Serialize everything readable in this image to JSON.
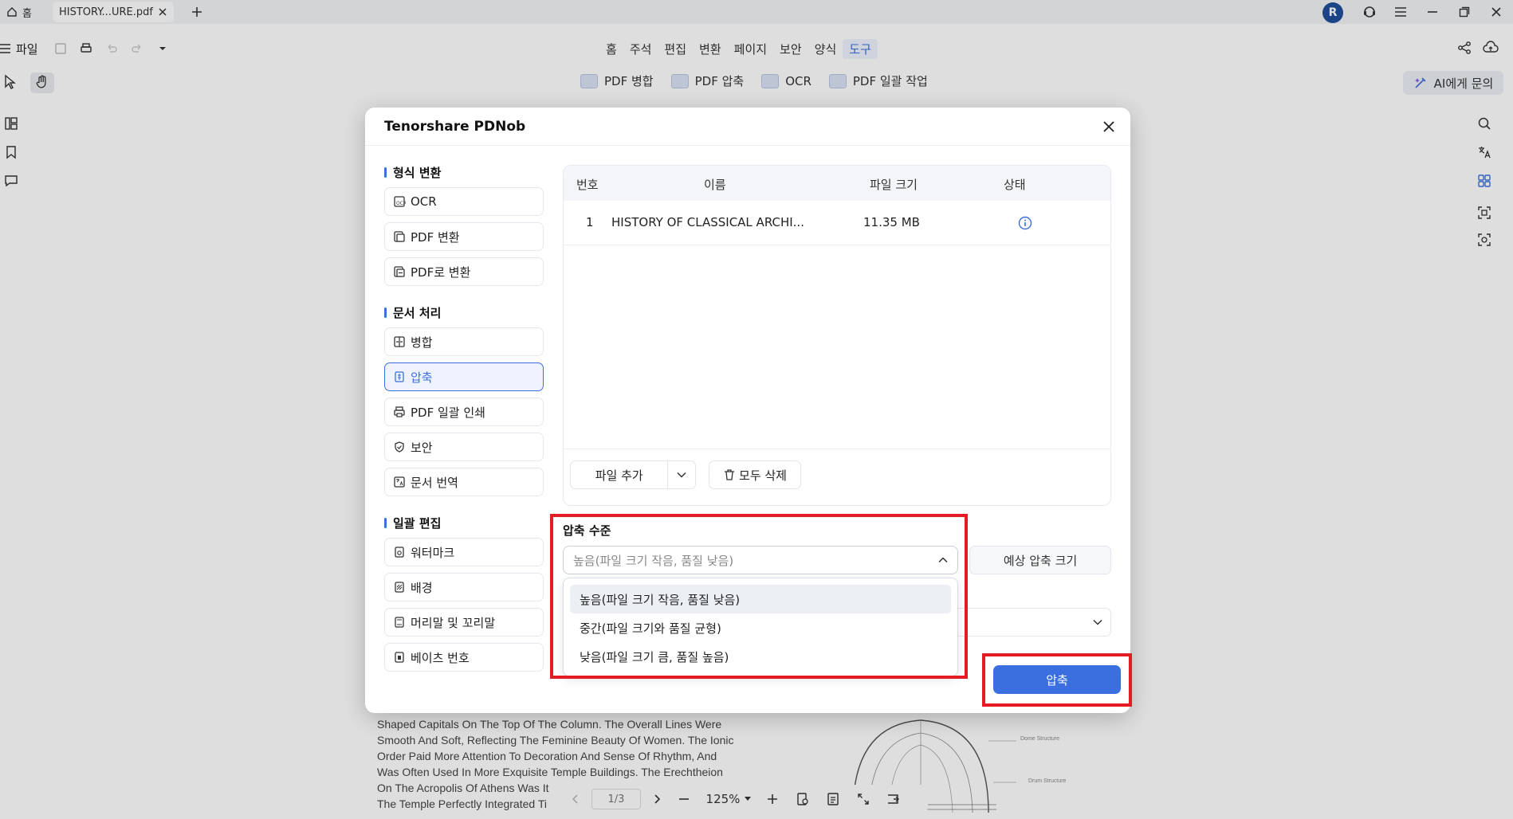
{
  "titlebar": {
    "home_tab": "홈",
    "doc_tab": "HISTORY...URE.pdf",
    "avatar_letter": "R"
  },
  "menubar": {
    "file_label": "파일",
    "items": [
      {
        "label": "홈"
      },
      {
        "label": "주석"
      },
      {
        "label": "편집"
      },
      {
        "label": "변환"
      },
      {
        "label": "페이지"
      },
      {
        "label": "보안"
      },
      {
        "label": "양식"
      },
      {
        "label": "도구"
      }
    ],
    "active_item": "도구"
  },
  "toolbar": {
    "items": [
      {
        "label": "PDF 병합"
      },
      {
        "label": "PDF 압축"
      },
      {
        "label": "OCR"
      },
      {
        "label": "PDF 일괄 작업"
      }
    ],
    "ai_label": "AI에게 문의"
  },
  "modal": {
    "title": "Tenorshare PDNob",
    "sections": [
      {
        "title": "형식 변환",
        "items": [
          {
            "label": "OCR",
            "icon": "ocr-icon"
          },
          {
            "label": "PDF 변환",
            "icon": "pdf-convert-icon"
          },
          {
            "label": "PDF로 변환",
            "icon": "to-pdf-icon"
          }
        ]
      },
      {
        "title": "문서 처리",
        "items": [
          {
            "label": "병합",
            "icon": "merge-icon"
          },
          {
            "label": "압축",
            "icon": "compress-icon",
            "active": true
          },
          {
            "label": "PDF 일괄 인쇄",
            "icon": "printer-icon"
          },
          {
            "label": "보안",
            "icon": "shield-icon"
          },
          {
            "label": "문서 번역",
            "icon": "translate-icon"
          }
        ]
      },
      {
        "title": "일괄 편집",
        "items": [
          {
            "label": "워터마크",
            "icon": "watermark-icon"
          },
          {
            "label": "배경",
            "icon": "background-icon"
          },
          {
            "label": "머리말 및 꼬리말",
            "icon": "header-footer-icon"
          },
          {
            "label": "베이츠 번호",
            "icon": "bates-number-icon"
          }
        ]
      }
    ],
    "table": {
      "headers": [
        "번호",
        "이름",
        "파일 크기",
        "상태"
      ],
      "rows": [
        {
          "number": "1",
          "name": "HISTORY OF CLASSICAL ARCHI...",
          "size": "11.35 MB",
          "status_icon": "info-icon"
        }
      ]
    },
    "add_file_label": "파일 추가",
    "delete_all_label": "모두 삭제",
    "compression": {
      "label": "압축 수준",
      "selected_value": "높음(파일 크기 작음, 품질 낮음)",
      "options": [
        "높음(파일 크기 작음, 품질 낮음)",
        "중간(파일 크기와 품질 균형)",
        "낮음(파일 크기 큼, 품질 높음)"
      ]
    },
    "estimate_label": "예상 압축 크기",
    "compress_button_label": "압축"
  },
  "document": {
    "text_lines": [
      "Shaped Capitals On The Top Of The Column. The Overall Lines Were",
      "Smooth And Soft, Reflecting The Feminine Beauty Of Women. The Ionic",
      "Order Paid More Attention To Decoration And Sense Of Rhythm, And",
      "Was Often Used In More Exquisite Temple Buildings. The Erechtheion",
      "On The Acropolis Of Athens Was It",
      "The Temple Perfectly Integrated Ti"
    ],
    "figure_labels": [
      "Dome Structure",
      "Drum Structure"
    ]
  },
  "bottombar": {
    "page_indicator": "1/3",
    "zoom": "125%"
  },
  "colors": {
    "accent": "#3b6fe0",
    "highlight_red": "#e21b25"
  }
}
